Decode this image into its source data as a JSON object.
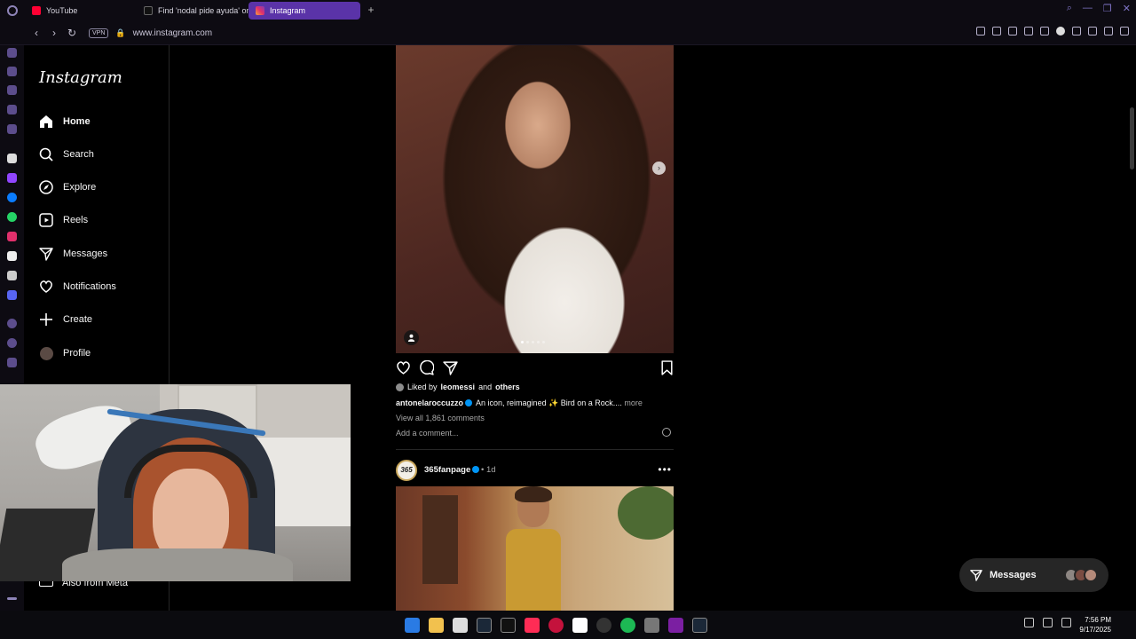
{
  "browser": {
    "tabs": [
      {
        "label": "YouTube",
        "active": false
      },
      {
        "label": "Find 'nodal pide ayuda' on TikTok",
        "active": false
      },
      {
        "label": "Instagram",
        "active": true
      }
    ],
    "new_tab": "+",
    "url": "www.instagram.com",
    "vpn_badge": "VPN"
  },
  "instagram": {
    "logo": "Instagram",
    "nav": [
      {
        "label": "Home",
        "icon": "home-icon",
        "active": true
      },
      {
        "label": "Search",
        "icon": "search-icon",
        "active": false
      },
      {
        "label": "Explore",
        "icon": "compass-icon",
        "active": false
      },
      {
        "label": "Reels",
        "icon": "reels-icon",
        "active": false
      },
      {
        "label": "Messages",
        "icon": "paper-plane-icon",
        "active": false
      },
      {
        "label": "Notifications",
        "icon": "heart-icon",
        "active": false
      },
      {
        "label": "Create",
        "icon": "plus-icon",
        "active": false
      },
      {
        "label": "Profile",
        "icon": "avatar",
        "active": false
      }
    ],
    "also_from_meta": "Also from Meta"
  },
  "post1": {
    "liked_by_prefix": "Liked by",
    "liked_by_user": "leomessi",
    "liked_by_joiner": "and",
    "liked_by_others": "others",
    "author": "antonelaroccuzzo",
    "caption": "An icon, reimagined ✨ Bird on a Rock....",
    "more": "more",
    "view_all": "View all 1,861 comments",
    "add_comment": "Add a comment..."
  },
  "post2": {
    "author": "365fanpage",
    "avatar_text": "365",
    "separator": "•",
    "time": "1d",
    "menu": "•••"
  },
  "messages_pill": {
    "label": "Messages"
  },
  "taskbar": {
    "time": "7:56 PM",
    "date": "9/17/2025"
  },
  "colors": {
    "accent": "#5a33a8",
    "verified": "#0095f6",
    "background": "#000000",
    "secondary_text": "#a8a8a8"
  }
}
